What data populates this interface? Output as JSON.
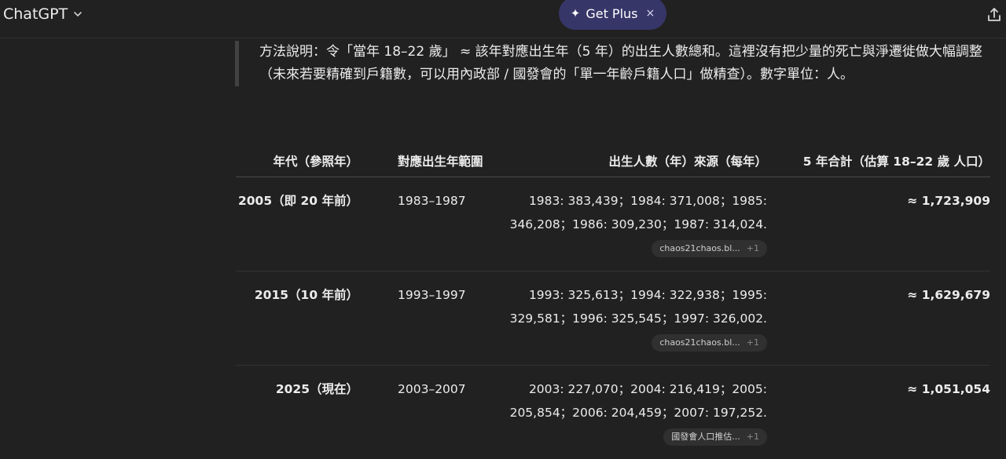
{
  "header": {
    "app_title": "ChatGPT",
    "plus_label": "Get Plus",
    "plus_spark": "✦",
    "plus_close": "×"
  },
  "quote": {
    "text": "方法說明：令「當年 18–22 歲」 ≈ 該年對應出生年（5 年）的出生人數總和。這裡沒有把少量的死亡與淨遷徙做大幅調整（未來若要精確到戶籍數，可以用內政部 / 國發會的「單一年齡戶籍人口」做精查）。數字單位：人。"
  },
  "table": {
    "headers": [
      "年代（參照年）",
      "對應出生年範圍",
      "出生人數（年）來源（每年）",
      "5 年合計（估算 18–22 歲 人口）"
    ],
    "rows": [
      {
        "era": "2005（即 20 年前）",
        "range": "1983–1987",
        "births": "1983: 383,439；1984: 371,008；1985: 346,208；1986: 309,230；1987: 314,024.",
        "cite_label": "chaos21chaos.bl...",
        "cite_more": "+1",
        "total": "≈ 1,723,909"
      },
      {
        "era": "2015（10 年前）",
        "range": "1993–1997",
        "births": "1993: 325,613；1994: 322,938；1995: 329,581；1996: 325,545；1997: 326,002.",
        "cite_label": "chaos21chaos.bl...",
        "cite_more": "+1",
        "total": "≈ 1,629,679"
      },
      {
        "era": "2025（現在）",
        "range": "2003–2007",
        "births": "2003: 227,070；2004: 216,419；2005: 205,854；2006: 204,459；2007: 197,252.",
        "cite_label": "國發會人口推估...",
        "cite_more": "+1",
        "total": "≈ 1,051,054"
      }
    ]
  },
  "icons": {
    "chevron": "chevron-down-icon",
    "share": "share-icon",
    "sparkle": "sparkle-icon",
    "close": "close-icon"
  },
  "colors": {
    "background": "#212121",
    "plus_pill": "#373669",
    "citation_chip": "#303030"
  }
}
